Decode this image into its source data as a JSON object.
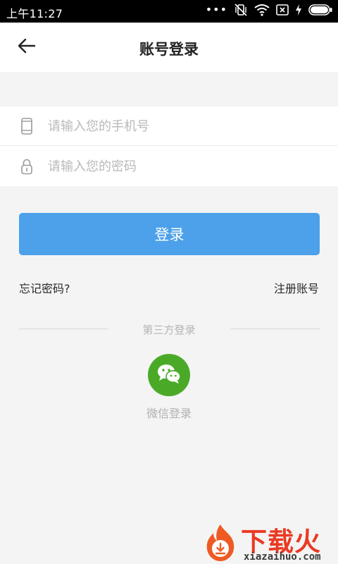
{
  "status_bar": {
    "time": "上午11:27",
    "dots": "•••",
    "icons": [
      "vibrate-off-icon",
      "wifi-icon",
      "no-sim-icon",
      "charging-icon",
      "battery-icon"
    ]
  },
  "header": {
    "back_icon": "arrow-left-icon",
    "title": "账号登录"
  },
  "form": {
    "phone": {
      "icon": "phone-icon",
      "placeholder": "请输入您的手机号",
      "value": ""
    },
    "password": {
      "icon": "lock-icon",
      "placeholder": "请输入您的密码",
      "value": ""
    }
  },
  "login_button": {
    "label": "登录",
    "color": "#4ca1ea"
  },
  "links": {
    "forgot": "忘记密码?",
    "register": "注册账号"
  },
  "third_party": {
    "heading": "第三方登录",
    "wechat": {
      "icon": "wechat-icon",
      "label": "微信登录",
      "color": "#4aaa28"
    }
  },
  "watermark": {
    "brand": "下载火",
    "url": "xiazaihuo.com",
    "color": "#ea3a23"
  }
}
